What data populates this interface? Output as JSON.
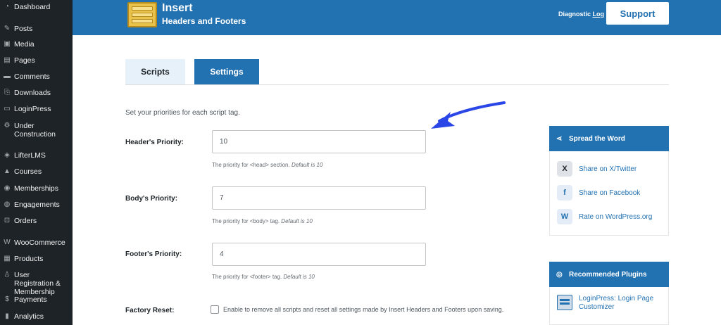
{
  "sidebar": {
    "items": [
      {
        "label": "Dashboard",
        "icon": "dashboard-icon",
        "glyph": "◔"
      },
      {
        "label": "Posts",
        "icon": "pin-icon",
        "glyph": "✎"
      },
      {
        "label": "Media",
        "icon": "media-icon",
        "glyph": "▣"
      },
      {
        "label": "Pages",
        "icon": "pages-icon",
        "glyph": "▤"
      },
      {
        "label": "Comments",
        "icon": "comments-icon",
        "glyph": "▬"
      },
      {
        "label": "Downloads",
        "icon": "downloads-icon",
        "glyph": "⎘"
      },
      {
        "label": "LoginPress",
        "icon": "loginpress-icon",
        "glyph": "▭"
      },
      {
        "label": "Under Construction",
        "icon": "gear-icon",
        "glyph": "⚙"
      },
      {
        "label": "LifterLMS",
        "icon": "lifterlms-icon",
        "glyph": "◈"
      },
      {
        "label": "Courses",
        "icon": "courses-icon",
        "glyph": "▲"
      },
      {
        "label": "Memberships",
        "icon": "memberships-icon",
        "glyph": "◉"
      },
      {
        "label": "Engagements",
        "icon": "engagements-icon",
        "glyph": "◍"
      },
      {
        "label": "Orders",
        "icon": "cart-icon",
        "glyph": "⊡"
      },
      {
        "label": "WooCommerce",
        "icon": "woocommerce-icon",
        "glyph": "W"
      },
      {
        "label": "Products",
        "icon": "products-icon",
        "glyph": "▦"
      },
      {
        "label": "User Registration & Membership",
        "icon": "user-registration-icon",
        "glyph": "♙"
      },
      {
        "label": "Payments",
        "icon": "payments-icon",
        "glyph": "$"
      },
      {
        "label": "Analytics",
        "icon": "analytics-icon",
        "glyph": "▮"
      }
    ]
  },
  "header": {
    "title": "Insert",
    "subtitle": "Headers and Footers",
    "diagnostic_prefix": "Diagnostic ",
    "diagnostic_underlined": "Log",
    "support_label": "Support"
  },
  "tabs": [
    {
      "label": "Scripts",
      "active": false
    },
    {
      "label": "Settings",
      "active": true
    }
  ],
  "settings": {
    "intro": "Set your priorities for each script tag.",
    "header_label": "Header's Priority:",
    "header_value": "10",
    "header_help": "The priority for <head> section.",
    "body_label": "Body's Priority:",
    "body_value": "7",
    "body_help": "The priority for <body> tag.",
    "footer_label": "Footer's Priority:",
    "footer_value": "4",
    "footer_help": "The priority for <footer> tag.",
    "default_text": "Default is 10",
    "reset_label": "Factory Reset:",
    "reset_text": "Enable to remove all scripts and reset all settings made by Insert Headers and Footers upon saving."
  },
  "spread": {
    "title": "Spread the Word",
    "items": [
      {
        "label": "Share on X/Twitter",
        "icon": "x-twitter-icon",
        "glyph": "X"
      },
      {
        "label": "Share on Facebook",
        "icon": "facebook-icon",
        "glyph": "f"
      },
      {
        "label": "Rate on WordPress.org",
        "icon": "wordpress-icon",
        "glyph": "W"
      }
    ]
  },
  "recommended": {
    "title": "Recommended Plugins",
    "items": [
      {
        "label": "LoginPress: Login Page Customizer"
      }
    ]
  },
  "colors": {
    "sidebar_bg": "#1d2327",
    "header_bg": "#2271b1",
    "accent": "#2271b1",
    "arrow": "#2b46e6"
  }
}
